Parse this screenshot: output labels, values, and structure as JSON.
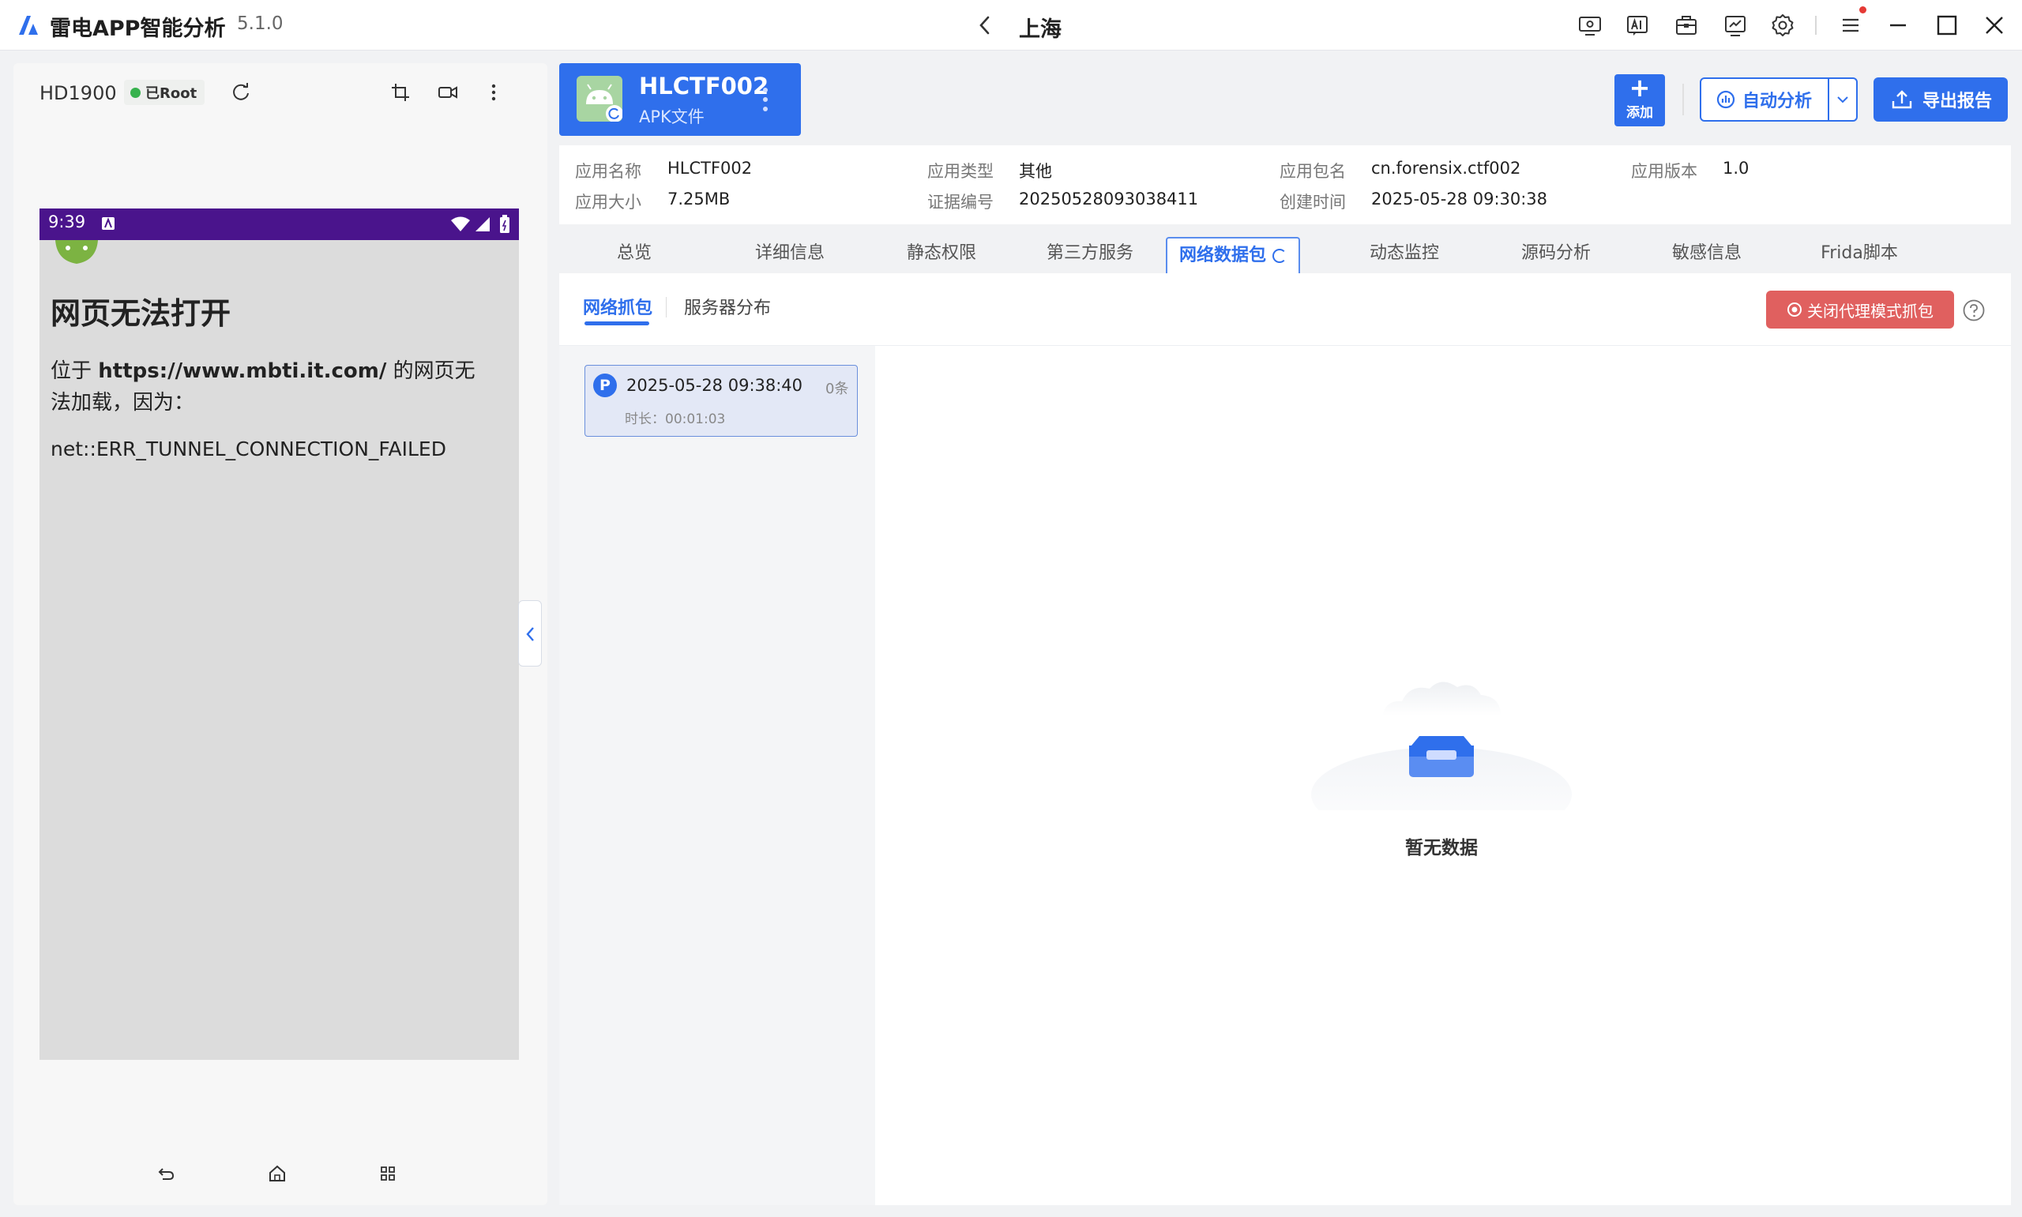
{
  "window": {
    "app_title": "雷电APP智能分析",
    "version": "5.1.0",
    "location_title": "上海"
  },
  "titlebar_icons": [
    "screen-cast-icon",
    "ai-icon",
    "toolbox-icon",
    "monitor-chart-icon",
    "settings-icon",
    "menu-icon",
    "minimize-icon",
    "maximize-icon",
    "close-icon"
  ],
  "device": {
    "name": "HD1900",
    "root_status": "已Root",
    "root_status_color": "#37b24d",
    "phone": {
      "status_time": "9:39",
      "status_bar_color": "#4a148c",
      "error_title": "网页无法打开",
      "error_desc_prefix": "位于 ",
      "error_url": "https://www.mbti.it.com/",
      "error_desc_suffix": " 的网页无法加载，因为：",
      "error_code": "net::ERR_TUNNEL_CONNECTION_FAILED"
    }
  },
  "app_card": {
    "name": "HLCTF002",
    "type": "APK文件"
  },
  "actions": {
    "add_label": "添加",
    "auto_analyze_label": "自动分析",
    "export_label": "导出报告",
    "accent_color": "#2f6fec"
  },
  "info": {
    "app_name_label": "应用名称",
    "app_name": "HLCTF002",
    "app_type_label": "应用类型",
    "app_type": "其他",
    "package_label": "应用包名",
    "package": "cn.forensix.ctf002",
    "version_label": "应用版本",
    "version": "1.0",
    "size_label": "应用大小",
    "size": "7.25MB",
    "evidence_label": "证据编号",
    "evidence": "20250528093038411",
    "created_label": "创建时间",
    "created": "2025-05-28 09:30:38"
  },
  "tabs": {
    "overview": "总览",
    "details": "详细信息",
    "permissions": "静态权限",
    "third_party": "第三方服务",
    "network": "网络数据包",
    "dynamic": "动态监控",
    "source": "源码分析",
    "sensitive": "敏感信息",
    "frida": "Frida脚本"
  },
  "network": {
    "subtab_capture": "网络抓包",
    "subtab_server": "服务器分布",
    "stop_proxy_label": "关闭代理模式抓包",
    "stop_proxy_color": "#e0605f",
    "session": {
      "badge": "P",
      "time": "2025-05-28 09:38:40",
      "count": "0条",
      "duration": "时长：00:01:03"
    },
    "empty_text": "暂无数据"
  }
}
